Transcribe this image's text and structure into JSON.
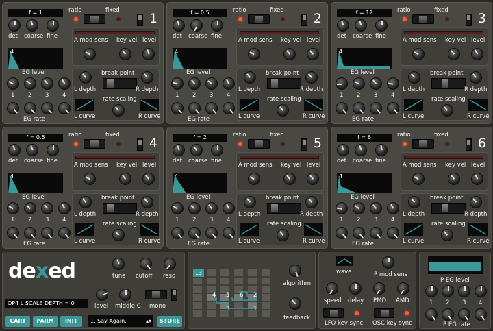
{
  "labels": {
    "ratio": "ratio",
    "fixed": "fixed",
    "det": "det",
    "coarse": "coarse",
    "fine": "fine",
    "a_mod_sens": "A mod sens",
    "key_vel": "key vel",
    "level": "level",
    "eg_level": "EG level",
    "break_point": "break point",
    "l_depth": "L depth",
    "r_depth": "R depth",
    "rate_scaling": "rate scaling",
    "l_curve": "L curve",
    "r_curve": "R curve",
    "eg_rate": "EG rate",
    "s1": "1",
    "s2": "2",
    "s3": "3",
    "s4": "4",
    "four": "4"
  },
  "operators": [
    {
      "number": "1",
      "freq": "f = 1"
    },
    {
      "number": "2",
      "freq": "f = 0.5"
    },
    {
      "number": "3",
      "freq": "f = 12"
    },
    {
      "number": "4",
      "freq": "f = 0.5"
    },
    {
      "number": "5",
      "freq": "f = 2"
    },
    {
      "number": "6",
      "freq": "f = 6"
    }
  ],
  "global": {
    "logo_a": "de",
    "logo_b": "x",
    "logo_c": "ed",
    "tune": "tune",
    "cutoff": "cutoff",
    "reso": "reso",
    "status": "OP4 L SCALE DEPTH = 0",
    "level": "level",
    "middle_c": "middle C",
    "mono": "mono",
    "cart": "CART",
    "parm": "PARM",
    "init": "INIT",
    "program": "1. Say Again.",
    "store": "STORE"
  },
  "algo": {
    "number": "13",
    "algorithm": "algorithm",
    "feedback": "feedback",
    "n1": "1",
    "n2": "2",
    "n3": "3",
    "n4": "4",
    "n5": "5",
    "n6": "6"
  },
  "lfo": {
    "wave": "wave",
    "p_mod_sens": "P mod sens",
    "speed": "speed",
    "delay": "delay",
    "pmd": "PMD",
    "amd": "AMD",
    "lfo_key_sync": "LFO key sync",
    "osc_key_sync": "OSC key sync"
  },
  "peg": {
    "title": "P EG level",
    "rate": "P EG rate",
    "s1": "1",
    "s2": "2",
    "s3": "3",
    "s4": "4"
  },
  "colors": {
    "accent": "#3a9898",
    "led": "#ff5a3a",
    "panel": "#494842"
  }
}
